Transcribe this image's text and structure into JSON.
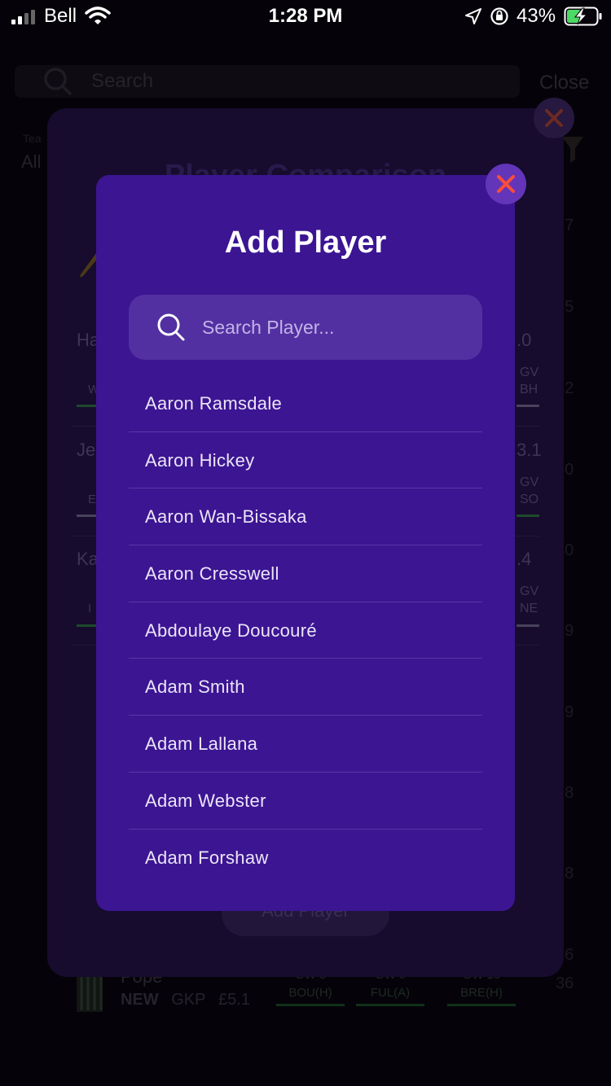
{
  "status_bar": {
    "carrier": "Bell",
    "time": "1:28 PM",
    "battery": "43%"
  },
  "background": {
    "search_placeholder": "Search",
    "close_label": "Close",
    "team_label": "Tea",
    "team_value": "All",
    "points": [
      "67",
      "45",
      "42",
      "40",
      "40",
      "39",
      "39",
      "38",
      "38",
      "36",
      "36"
    ],
    "bottom_player": {
      "name": "Pope",
      "status": "NEW",
      "position": "GKP",
      "price": "£5.1",
      "fixtures": [
        {
          "gw": "GW 8",
          "opp": "BOU(H)"
        },
        {
          "gw": "GW 9",
          "opp": "FUL(A)"
        },
        {
          "gw": "GW 10",
          "opp": "BRE(H)"
        }
      ],
      "points": "36"
    }
  },
  "comparison_modal": {
    "title": "Player Comparison",
    "rows": [
      {
        "name": "Ha",
        "value": ".0",
        "left_small": "W",
        "gw": "GV",
        "opp": "BH"
      },
      {
        "name": "Je",
        "value": "3.1",
        "left_small": "E",
        "gw": "GV",
        "opp": "SO"
      },
      {
        "name": "Ka",
        "value": ".4",
        "left_small": "I",
        "gw": "GV",
        "opp": "NE"
      }
    ],
    "add_button": "Add Player"
  },
  "add_player_modal": {
    "title": "Add Player",
    "search_placeholder": "Search Player...",
    "players": [
      "Aaron Ramsdale",
      "Aaron Hickey",
      "Aaron Wan-Bissaka",
      "Aaron Cresswell",
      "Abdoulaye Doucouré",
      "Adam Smith",
      "Adam Lallana",
      "Adam Webster",
      "Adam Forshaw"
    ]
  },
  "colors": {
    "modal_bg": "#3c1592",
    "search_bg": "#5230a2",
    "close_x": "#ff4d3a",
    "page_bg": "#050309"
  }
}
